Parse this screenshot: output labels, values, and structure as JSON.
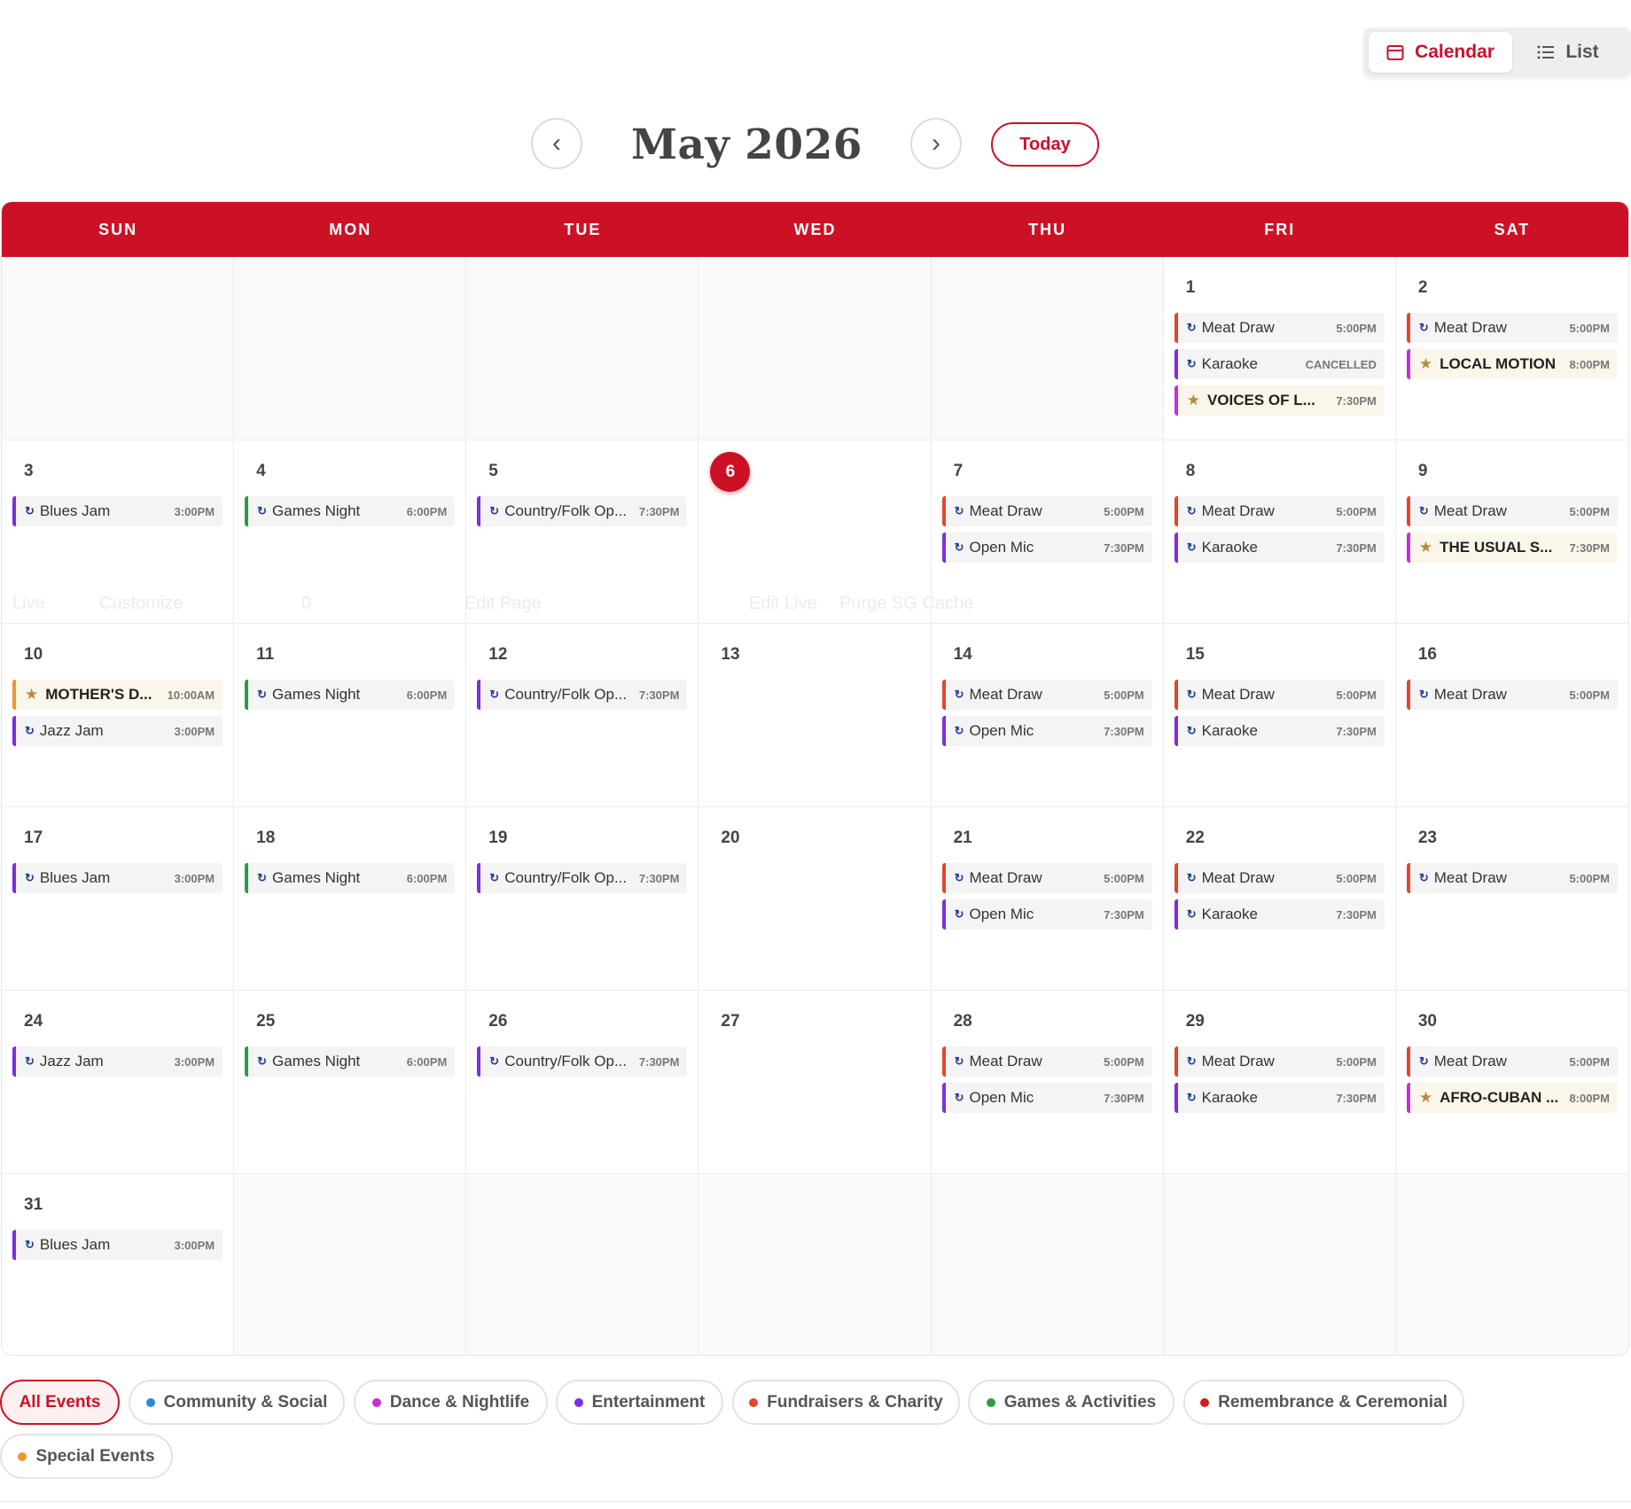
{
  "view_toggle": {
    "calendar": "Calendar",
    "list": "List"
  },
  "month_nav": {
    "prev": "‹",
    "title": "May 2026",
    "next": "›",
    "today": "Today"
  },
  "weekdays": [
    "SUN",
    "MON",
    "TUE",
    "WED",
    "THU",
    "FRI",
    "SAT"
  ],
  "colors": {
    "brand": "#cd1125",
    "entertainment": "#7b2fe0",
    "games": "#2e9a45",
    "fundraisers": "#e0472a",
    "dance": "#c42fd6",
    "special": "#f0952b",
    "community": "#2f86d6",
    "remembrance": "#d21e1e"
  },
  "today_day": 6,
  "ghost_toolbar": [
    "Live",
    "Customize",
    "0",
    "Edit Page",
    "Edit Live",
    "Purge SG Cache"
  ],
  "days": [
    {
      "day": null,
      "events": []
    },
    {
      "day": null,
      "events": []
    },
    {
      "day": null,
      "events": []
    },
    {
      "day": null,
      "events": []
    },
    {
      "day": null,
      "events": []
    },
    {
      "day": 1,
      "events": [
        {
          "title": "Meat Draw",
          "time": "5:00PM",
          "category": "fundraisers"
        },
        {
          "title": "Karaoke",
          "time": "CANCELLED",
          "category": "entertainment"
        },
        {
          "title": "VOICES OF L...",
          "time": "7:30PM",
          "category": "dance",
          "special": true
        }
      ]
    },
    {
      "day": 2,
      "events": [
        {
          "title": "Meat Draw",
          "time": "5:00PM",
          "category": "fundraisers"
        },
        {
          "title": "LOCAL MOTION",
          "time": "8:00PM",
          "category": "dance",
          "special": true
        }
      ]
    },
    {
      "day": 3,
      "events": [
        {
          "title": "Blues Jam",
          "time": "3:00PM",
          "category": "entertainment"
        }
      ]
    },
    {
      "day": 4,
      "events": [
        {
          "title": "Games Night",
          "time": "6:00PM",
          "category": "games"
        }
      ]
    },
    {
      "day": 5,
      "events": [
        {
          "title": "Country/Folk Op...",
          "time": "7:30PM",
          "category": "entertainment"
        }
      ]
    },
    {
      "day": 6,
      "events": []
    },
    {
      "day": 7,
      "events": [
        {
          "title": "Meat Draw",
          "time": "5:00PM",
          "category": "fundraisers"
        },
        {
          "title": "Open Mic",
          "time": "7:30PM",
          "category": "entertainment"
        }
      ]
    },
    {
      "day": 8,
      "events": [
        {
          "title": "Meat Draw",
          "time": "5:00PM",
          "category": "fundraisers"
        },
        {
          "title": "Karaoke",
          "time": "7:30PM",
          "category": "entertainment"
        }
      ]
    },
    {
      "day": 9,
      "events": [
        {
          "title": "Meat Draw",
          "time": "5:00PM",
          "category": "fundraisers"
        },
        {
          "title": "THE USUAL S...",
          "time": "7:30PM",
          "category": "dance",
          "special": true
        }
      ]
    },
    {
      "day": 10,
      "events": [
        {
          "title": "MOTHER'S D...",
          "time": "10:00AM",
          "category": "special",
          "special": true
        },
        {
          "title": "Jazz Jam",
          "time": "3:00PM",
          "category": "entertainment"
        }
      ]
    },
    {
      "day": 11,
      "events": [
        {
          "title": "Games Night",
          "time": "6:00PM",
          "category": "games"
        }
      ]
    },
    {
      "day": 12,
      "events": [
        {
          "title": "Country/Folk Op...",
          "time": "7:30PM",
          "category": "entertainment"
        }
      ]
    },
    {
      "day": 13,
      "events": []
    },
    {
      "day": 14,
      "events": [
        {
          "title": "Meat Draw",
          "time": "5:00PM",
          "category": "fundraisers"
        },
        {
          "title": "Open Mic",
          "time": "7:30PM",
          "category": "entertainment"
        }
      ]
    },
    {
      "day": 15,
      "events": [
        {
          "title": "Meat Draw",
          "time": "5:00PM",
          "category": "fundraisers"
        },
        {
          "title": "Karaoke",
          "time": "7:30PM",
          "category": "entertainment"
        }
      ]
    },
    {
      "day": 16,
      "events": [
        {
          "title": "Meat Draw",
          "time": "5:00PM",
          "category": "fundraisers"
        }
      ]
    },
    {
      "day": 17,
      "events": [
        {
          "title": "Blues Jam",
          "time": "3:00PM",
          "category": "entertainment"
        }
      ]
    },
    {
      "day": 18,
      "events": [
        {
          "title": "Games Night",
          "time": "6:00PM",
          "category": "games"
        }
      ]
    },
    {
      "day": 19,
      "events": [
        {
          "title": "Country/Folk Op...",
          "time": "7:30PM",
          "category": "entertainment"
        }
      ]
    },
    {
      "day": 20,
      "events": []
    },
    {
      "day": 21,
      "events": [
        {
          "title": "Meat Draw",
          "time": "5:00PM",
          "category": "fundraisers"
        },
        {
          "title": "Open Mic",
          "time": "7:30PM",
          "category": "entertainment"
        }
      ]
    },
    {
      "day": 22,
      "events": [
        {
          "title": "Meat Draw",
          "time": "5:00PM",
          "category": "fundraisers"
        },
        {
          "title": "Karaoke",
          "time": "7:30PM",
          "category": "entertainment"
        }
      ]
    },
    {
      "day": 23,
      "events": [
        {
          "title": "Meat Draw",
          "time": "5:00PM",
          "category": "fundraisers"
        }
      ]
    },
    {
      "day": 24,
      "events": [
        {
          "title": "Jazz Jam",
          "time": "3:00PM",
          "category": "entertainment"
        }
      ]
    },
    {
      "day": 25,
      "events": [
        {
          "title": "Games Night",
          "time": "6:00PM",
          "category": "games"
        }
      ]
    },
    {
      "day": 26,
      "events": [
        {
          "title": "Country/Folk Op...",
          "time": "7:30PM",
          "category": "entertainment"
        }
      ]
    },
    {
      "day": 27,
      "events": []
    },
    {
      "day": 28,
      "events": [
        {
          "title": "Meat Draw",
          "time": "5:00PM",
          "category": "fundraisers"
        },
        {
          "title": "Open Mic",
          "time": "7:30PM",
          "category": "entertainment"
        }
      ]
    },
    {
      "day": 29,
      "events": [
        {
          "title": "Meat Draw",
          "time": "5:00PM",
          "category": "fundraisers"
        },
        {
          "title": "Karaoke",
          "time": "7:30PM",
          "category": "entertainment"
        }
      ]
    },
    {
      "day": 30,
      "events": [
        {
          "title": "Meat Draw",
          "time": "5:00PM",
          "category": "fundraisers"
        },
        {
          "title": "AFRO-CUBAN ...",
          "time": "8:00PM",
          "category": "dance",
          "special": true
        }
      ]
    },
    {
      "day": 31,
      "events": [
        {
          "title": "Blues Jam",
          "time": "3:00PM",
          "category": "entertainment"
        }
      ]
    },
    {
      "day": null,
      "events": []
    },
    {
      "day": null,
      "events": []
    },
    {
      "day": null,
      "events": []
    },
    {
      "day": null,
      "events": []
    },
    {
      "day": null,
      "events": []
    },
    {
      "day": null,
      "events": []
    }
  ],
  "filters": [
    {
      "label": "All Events",
      "active": true
    },
    {
      "label": "Community & Social",
      "color": "#2f86d6"
    },
    {
      "label": "Dance & Nightlife",
      "color": "#c42fd6"
    },
    {
      "label": "Entertainment",
      "color": "#7b2fe0"
    },
    {
      "label": "Fundraisers & Charity",
      "color": "#e0472a"
    },
    {
      "label": "Games & Activities",
      "color": "#2e9a45"
    },
    {
      "label": "Remembrance & Ceremonial",
      "color": "#d21e1e"
    },
    {
      "label": "Special Events",
      "color": "#f0952b"
    }
  ]
}
